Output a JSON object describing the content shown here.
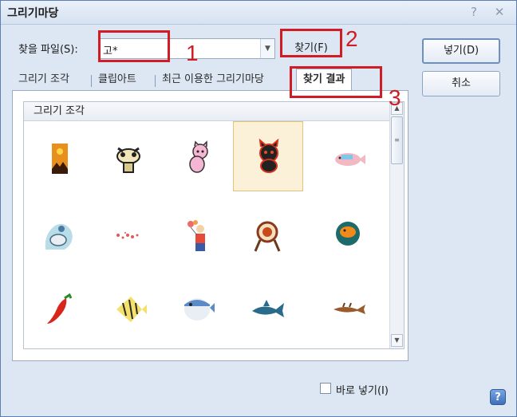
{
  "window": {
    "title": "그리기마당",
    "help_button": "?",
    "close_button": "✕"
  },
  "search": {
    "label": "찾을 파일(S):",
    "value": "고*",
    "find_button": "찾기(F)"
  },
  "buttons": {
    "insert": "넣기(D)",
    "cancel": "취소"
  },
  "tabs": [
    {
      "label": "그리기 조각",
      "active": false
    },
    {
      "label": "클립아트",
      "active": false
    },
    {
      "label": "최근 이용한 그리기마당",
      "active": false
    },
    {
      "label": "찾기 결과",
      "active": true
    }
  ],
  "gallery": {
    "header": "그리기 조각",
    "items": [
      {
        "icon": "sunset-landscape-icon"
      },
      {
        "icon": "cow-cartoon-icon"
      },
      {
        "icon": "pink-cat-icon"
      },
      {
        "icon": "black-cat-icon",
        "selected": true
      },
      {
        "icon": "pink-fish-icon"
      },
      {
        "icon": "bird-icon"
      },
      {
        "icon": "dots-icon"
      },
      {
        "icon": "clown-balloons-icon"
      },
      {
        "icon": "archer-target-icon"
      },
      {
        "icon": "orange-circle-icon"
      },
      {
        "icon": "red-pepper-icon"
      },
      {
        "icon": "angelfish-icon"
      },
      {
        "icon": "pufferfish-icon"
      },
      {
        "icon": "blue-fish-icon"
      },
      {
        "icon": "brown-fish-icon"
      }
    ]
  },
  "options": {
    "direct_insert": "바로 넣기(I)"
  },
  "annotations": [
    {
      "number": "1"
    },
    {
      "number": "2"
    },
    {
      "number": "3"
    }
  ],
  "colors": {
    "highlight": "#d01c24",
    "selection": "#fbf1d8"
  }
}
